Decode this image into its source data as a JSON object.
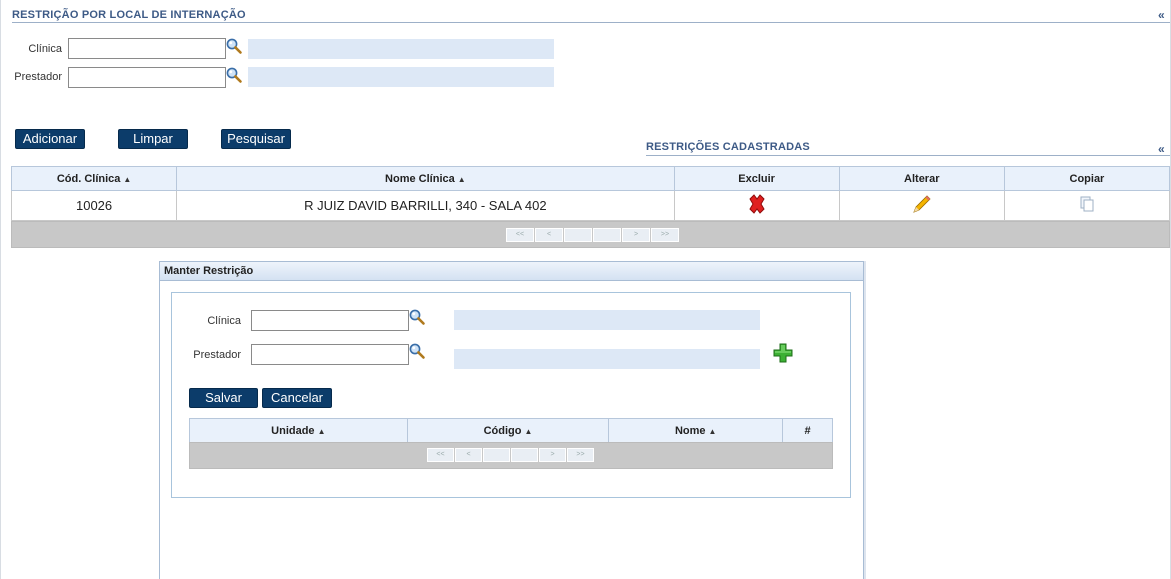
{
  "section": {
    "title": "RESTRIÇÃO POR LOCAL DE INTERNAÇÃO",
    "collapse": "«"
  },
  "filters": {
    "clinica_label": "Clínica",
    "clinica_value": "",
    "prestador_label": "Prestador",
    "prestador_value": ""
  },
  "actions": {
    "add": "Adicionar",
    "clear": "Limpar",
    "search": "Pesquisar"
  },
  "grid": {
    "title": "RESTRIÇÕES CADASTRADAS",
    "collapse": "«",
    "columns": [
      "Cód. Clínica",
      "Nome Clínica",
      "Excluir",
      "Alterar",
      "Copiar"
    ],
    "rows": [
      {
        "code": "10026",
        "name": "R JUIZ DAVID BARRILLI, 340 - SALA 402"
      }
    ],
    "pager": [
      "<<",
      "<",
      "",
      "",
      ">",
      ">>"
    ]
  },
  "modal": {
    "title": "Manter Restrição",
    "clinica_label": "Clínica",
    "clinica_value": "",
    "prestador_label": "Prestador",
    "prestador_value": "",
    "save": "Salvar",
    "cancel": "Cancelar",
    "columns": [
      "Unidade",
      "Código",
      "Nome",
      "#"
    ],
    "pager": [
      "<<",
      "<",
      "",
      "",
      ">",
      ">>"
    ]
  },
  "colors": {
    "accent": "#0c3c6a",
    "title": "#3d5a86",
    "desc_field": "#dde8f6",
    "header_bg": "#e9f1fb"
  },
  "icons": {
    "lookup": "magnifier-icon",
    "delete": "red-x-icon",
    "edit": "pencil-icon",
    "copy": "copy-icon",
    "add": "green-plus-icon"
  }
}
